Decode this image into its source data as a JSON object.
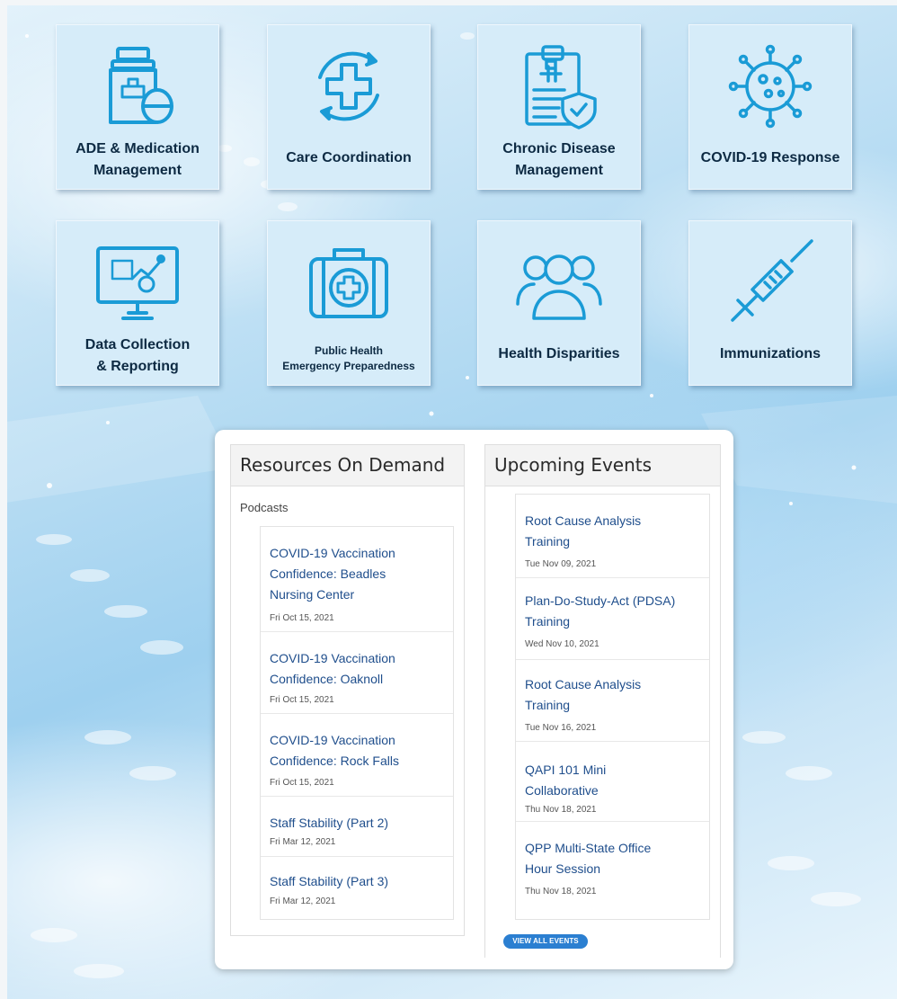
{
  "tiles": [
    {
      "label_line1": "ADE & Medication",
      "label_line2": "Management",
      "icon": "medication-bottle-icon"
    },
    {
      "label_line1": "Care Coordination",
      "label_line2": "",
      "icon": "cross-cycle-icon"
    },
    {
      "label_line1": "Chronic Disease",
      "label_line2": "Management",
      "icon": "clipboard-shield-icon"
    },
    {
      "label_line1": "COVID-19 Response",
      "label_line2": "",
      "icon": "virus-icon"
    },
    {
      "label_line1": "Data Collection",
      "label_line2": "& Reporting",
      "icon": "monitor-chart-icon"
    },
    {
      "label_line1": "Public Health",
      "label_line2": "Emergency Preparedness",
      "icon": "first-aid-kit-icon"
    },
    {
      "label_line1": "Health Disparities",
      "label_line2": "",
      "icon": "people-group-icon"
    },
    {
      "label_line1": "Immunizations",
      "label_line2": "",
      "icon": "syringe-icon"
    }
  ],
  "resources": {
    "title": "Resources On Demand",
    "section_label": "Podcasts",
    "items": [
      {
        "title": "COVID-19 Vaccination Confidence: Beadles Nursing Center",
        "date": "Fri Oct 15, 2021"
      },
      {
        "title": "COVID-19 Vaccination Confidence: Oaknoll",
        "date": "Fri Oct 15, 2021"
      },
      {
        "title": "COVID-19 Vaccination Confidence: Rock Falls",
        "date": "Fri Oct 15, 2021"
      },
      {
        "title": "Staff Stability (Part 2)",
        "date": "Fri Mar 12, 2021"
      },
      {
        "title": "Staff Stability (Part 3)",
        "date": "Fri Mar 12, 2021"
      }
    ]
  },
  "events": {
    "title": "Upcoming Events",
    "items": [
      {
        "title": "Root Cause Analysis Training",
        "date": "Tue Nov 09, 2021"
      },
      {
        "title": "Plan-Do-Study-Act (PDSA) Training",
        "date": "Wed Nov 10, 2021"
      },
      {
        "title": "Root Cause Analysis Training",
        "date": "Tue Nov 16, 2021"
      },
      {
        "title": "QAPI 101 Mini Collaborative",
        "date": "Thu Nov 18, 2021"
      },
      {
        "title": "QPP Multi-State Office Hour Session",
        "date": "Thu Nov 18, 2021"
      }
    ],
    "view_all_label": "VIEW ALL EVENTS"
  },
  "colors": {
    "icon": "#1a9bd6",
    "link": "#1f4e8c",
    "button": "#2b7fd1",
    "tile_bg": "#d6ecf9"
  }
}
